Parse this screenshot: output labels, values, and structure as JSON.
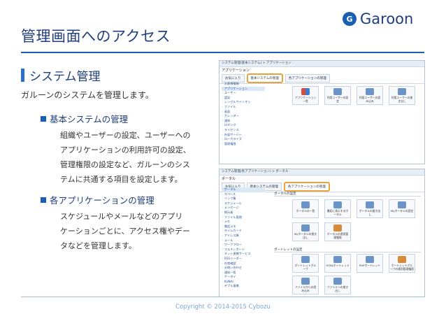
{
  "header": {
    "title": "管理画面へのアクセス",
    "logo_mark": "G",
    "logo_text": "Garoon"
  },
  "content": {
    "section_title": "システム管理",
    "intro": "ガルーンのシステムを管理します。",
    "items": [
      {
        "heading": "基本システムの管理",
        "lines": [
          "組織やユーザーの設定、ユーザーへの",
          "アプリケーションの利用許可の設定、",
          "管理権限の設定など、ガルーンのシス",
          "テムに共通する項目を設定します。"
        ]
      },
      {
        "heading": "各アプリケーションの管理",
        "lines": [
          "スケジュールやメールなどのアプリ",
          "ケーションごとに、アクセス権やデー",
          "タなどを管理します。"
        ]
      }
    ]
  },
  "footer": {
    "copyright": "Copyright © 2014-2015 Cybozu"
  },
  "screenshot1": {
    "crumb": "システム管理(基本システム) > アプリケーション",
    "subtitle": "アプリケーション",
    "tabs": [
      "お気に入り",
      "基本システムの管理",
      "各アプリケーションの管理"
    ],
    "sidebar": [
      "お客様情報",
      "アプリケーション",
      "ユーザー",
      "認証",
      "シングルサインオン",
      "ファイル",
      "画面",
      "カレンダー",
      "通知",
      "ロギング",
      "ライセンス",
      "外部サーバー",
      "ローカライズ",
      "管理権限"
    ],
    "icons": [
      "アプリケーション一覧",
      "利用ユーザーの設定",
      "利用ユーザーの読み込み",
      "利用ユーザーの書き出し"
    ]
  },
  "screenshot2": {
    "crumb": "システム管理(各アプリケーション) > ポータル",
    "subtitle": "ポータル",
    "tabs": [
      "お気に入り",
      "基本システムの管理",
      "各アプリケーションの管理"
    ],
    "sidebar": [
      "ポータル",
      "スペース",
      "リンク集",
      "スケジュール",
      "メッセージ",
      "掲示板",
      "ファイル管理",
      "メモ",
      "電話メモ",
      "タイムカード",
      "アドレス帳",
      "メール",
      "ワークフロー",
      "マルチレポート",
      "ネット連携サービス",
      "RSSリーダー",
      "在席確認",
      "お問い合わせ",
      "通知一覧",
      "ケータイ",
      "KUNAI",
      "デブル連携"
    ],
    "group1": "ポータルの設定",
    "icons1": [
      "ポータルの一覧",
      "最初に表示するポータル",
      "ポータルの書き出し",
      "Myポータルの設定",
      "Myポータルの書き出し",
      "ポータルの運用管理権限"
    ],
    "group2": "ポートレットの設定",
    "icons2": [
      "ポートレットグループ",
      "HTMLポートレット",
      "PHPポートレット",
      "ポートレットグループの運用管理権限",
      "ファイルからの読み込み",
      "ファイルへの書き出し"
    ]
  }
}
